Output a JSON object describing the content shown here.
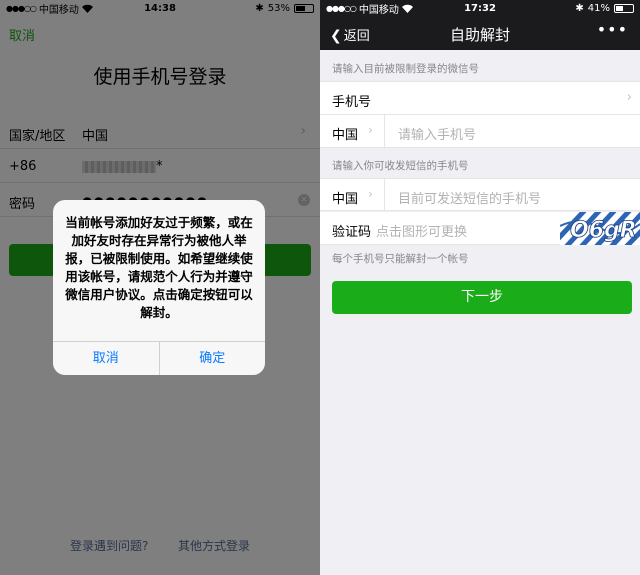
{
  "left_screen": {
    "status_bar": {
      "carrier": "中国移动",
      "time": "14:38",
      "battery": "53%"
    },
    "cancel_label": "取消",
    "title": "使用手机号登录",
    "region_label": "国家/地区",
    "region_value": "中国",
    "phone_prefix": "+86",
    "phone_value_tail": "*",
    "password_label": "密码",
    "password_dots": "●●●●●●●●●●●",
    "alert": {
      "message": "当前帐号添加好友过于频繁，或在加好友时存在异常行为被他人举报，已被限制使用。如希望继续使用该帐号，请规范个人行为并遵守微信用户协议。点击确定按钮可以解封。",
      "cancel_label": "取消",
      "confirm_label": "确定"
    },
    "link_problem": "登录遇到问题?",
    "link_other": "其他方式登录"
  },
  "right_screen": {
    "status_bar": {
      "carrier": "中国移动",
      "time": "17:32",
      "battery": "41%"
    },
    "back_label": "返回",
    "title": "自助解封",
    "hint_restricted": "请输入目前被限制登录的微信号",
    "phone_row_label": "手机号",
    "country_code": "中国",
    "phone_placeholder": "请输入手机号",
    "hint_sms": "请输入你可收发短信的手机号",
    "country_code_2": "中国",
    "sms_phone_placeholder": "目前可发送短信的手机号",
    "captcha_label": "验证码",
    "captcha_placeholder": "点击图形可更换",
    "captcha_text": "O6gR",
    "hint_bottom": "每个手机号只能解封一个帐号",
    "next_button": "下一步"
  },
  "colors": {
    "wechat_green": "#1aad19",
    "ios_blue": "#0a7aff",
    "link_blue": "#576b95",
    "nav_dark": "#1b1b1d"
  }
}
